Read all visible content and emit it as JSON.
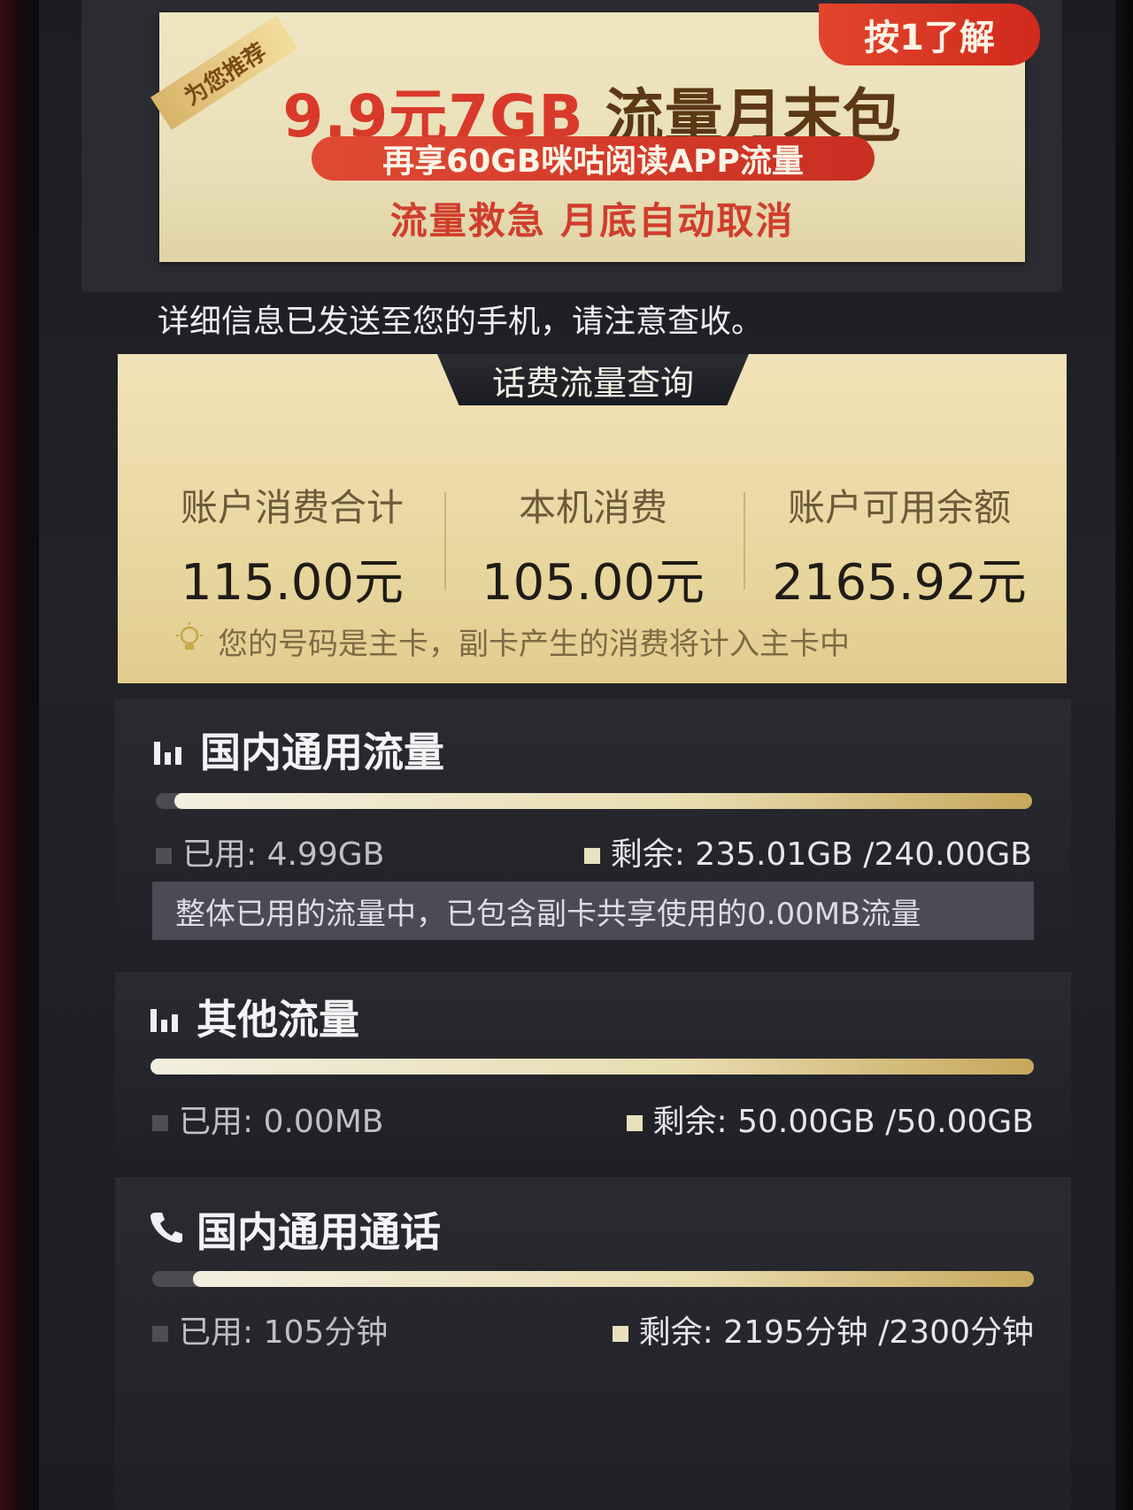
{
  "promo": {
    "ribbon": "为您推荐",
    "button": "按1了解",
    "title_price": "9.9元7GB",
    "title_name": "流量月末包",
    "pill": "再享60GB咪咕阅读APP流量",
    "subtitle": "流量救急  月底自动取消"
  },
  "notice": "详细信息已发送至您的手机，请注意查收。",
  "balance": {
    "tab": "话费流量查询",
    "items": [
      {
        "label": "账户消费合计",
        "value": "115.00元"
      },
      {
        "label": "本机消费",
        "value": "105.00元"
      },
      {
        "label": "账户可用余额",
        "value": "2165.92元"
      }
    ],
    "note": "您的号码是主卡，副卡产生的消费将计入主卡中"
  },
  "usage": [
    {
      "title": "国内通用流量",
      "icon": "bar-chart-icon",
      "used": "已用: 4.99GB",
      "remain": "剩余: 235.01GB /240.00GB",
      "remaining_fraction": 0.979,
      "shared_note": "整体已用的流量中，已包含副卡共享使用的0.00MB流量"
    },
    {
      "title": "其他流量",
      "icon": "bar-chart-icon",
      "used": "已用: 0.00MB",
      "remain": "剩余: 50.00GB /50.00GB",
      "remaining_fraction": 1.0
    },
    {
      "title": "国内通用通话",
      "icon": "phone-icon",
      "used": "已用: 105分钟",
      "remain": "剩余: 2195分钟 /2300分钟",
      "remaining_fraction": 0.954
    }
  ],
  "colors": {
    "accent_red": "#d9392a",
    "gold": "#e9dfb8",
    "bar_fill": "#e8dcb0",
    "background": "#1c1d22"
  }
}
